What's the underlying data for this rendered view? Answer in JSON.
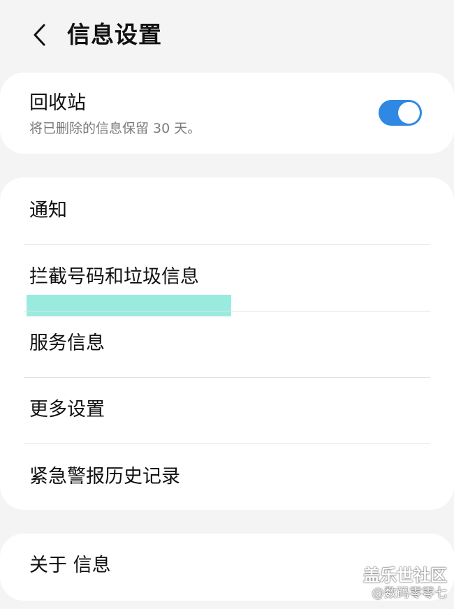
{
  "header": {
    "back_icon": "chevron-left-icon",
    "title": "信息设置"
  },
  "recycle_bin": {
    "title": "回收站",
    "subtitle": "将已删除的信息保留 30 天。",
    "toggle_on": true,
    "toggle_color": "#2f88e3"
  },
  "menu": {
    "items": [
      {
        "label": "通知"
      },
      {
        "label": "拦截号码和垃圾信息"
      },
      {
        "label": "服务信息"
      },
      {
        "label": "更多设置"
      },
      {
        "label": "紧急警报历史记录"
      }
    ]
  },
  "about": {
    "label": "关于 信息"
  },
  "watermark": {
    "main": "盖乐世社区",
    "sub": "@数码零零七"
  },
  "highlight_color": "#8fe9dc"
}
